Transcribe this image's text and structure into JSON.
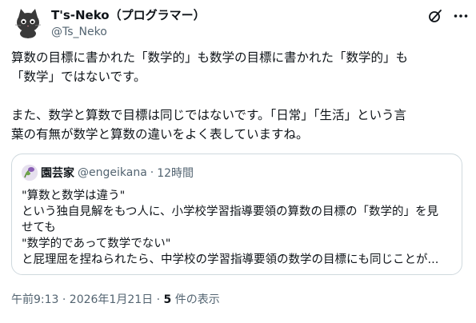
{
  "author": {
    "display_name": "T's-Neko（プログラマー）",
    "handle": "@Ts_Neko"
  },
  "tweet": {
    "text": "算数の目標に書かれた「数学的」も数学の目標に書かれた「数学的」も\n「数学」ではないです。\n\nまた、数学と算数で目標は同じではないです。「日常」「生活」という言\n葉の有無が数学と算数の違いをよく表していますね。"
  },
  "quoted": {
    "display_name": "園芸家",
    "handle": "@engeikana",
    "separator": "·",
    "time": "12時間",
    "text": "\"算数と数学は違う\"\nという独自見解をもつ人に、小学校学習指導要領の算数の目標の「数学的」を見\nせても\n\"数学的であって数学でない\"\nと屁理屈を捏ねられたら、中学校の学習指導要領の数学の目標にも同じことが..."
  },
  "footer": {
    "timestamp": "午前9:13 · 2026年1月21日 ·",
    "views_count": "5",
    "views_label": "件の表示"
  },
  "icons": {
    "grok": "grok-icon",
    "more": "more-icon"
  }
}
